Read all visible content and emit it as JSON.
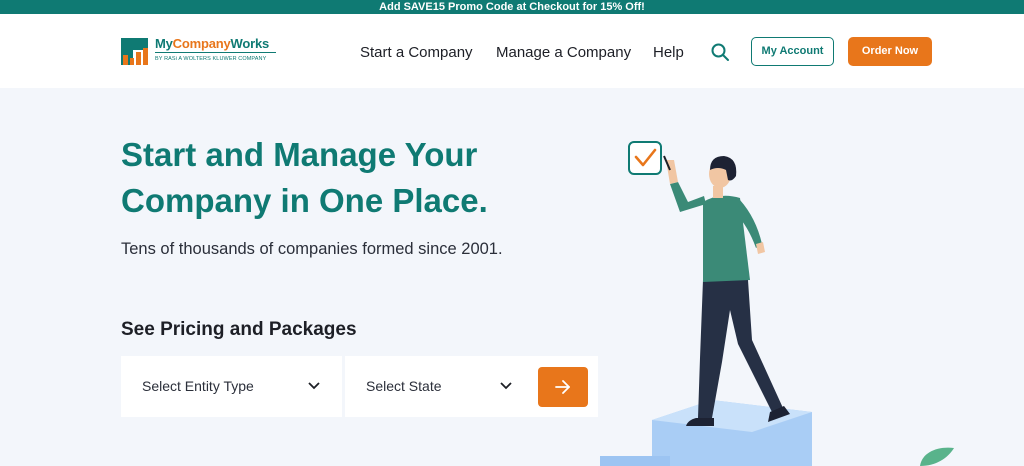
{
  "promo": {
    "text": "Add SAVE15 Promo Code at Checkout for 15% Off!"
  },
  "header": {
    "logo": {
      "name_part1": "My",
      "name_part2": "Company",
      "name_part3": "Works",
      "tagline": "BY RASi A WOLTERS KLUWER COMPANY"
    },
    "nav": [
      {
        "label": "Start a Company"
      },
      {
        "label": "Manage a Company"
      },
      {
        "label": "Help"
      }
    ],
    "search_icon": "search-icon",
    "my_account_label": "My Account",
    "order_now_label": "Order Now"
  },
  "hero": {
    "title_line1": "Start and Manage Your",
    "title_line2": "Company in One Place.",
    "subtitle": "Tens of thousands of companies formed since 2001."
  },
  "pricing": {
    "title": "See Pricing and Packages",
    "entity_select": {
      "value": "Select Entity Type",
      "icon": "chevron-down-icon"
    },
    "state_select": {
      "value": "Select State",
      "icon": "chevron-down-icon"
    },
    "go_button_icon": "arrow-right-icon"
  },
  "colors": {
    "teal": "#0f7a73",
    "orange": "#e8761b",
    "hero_bg": "#f3f6fb"
  }
}
